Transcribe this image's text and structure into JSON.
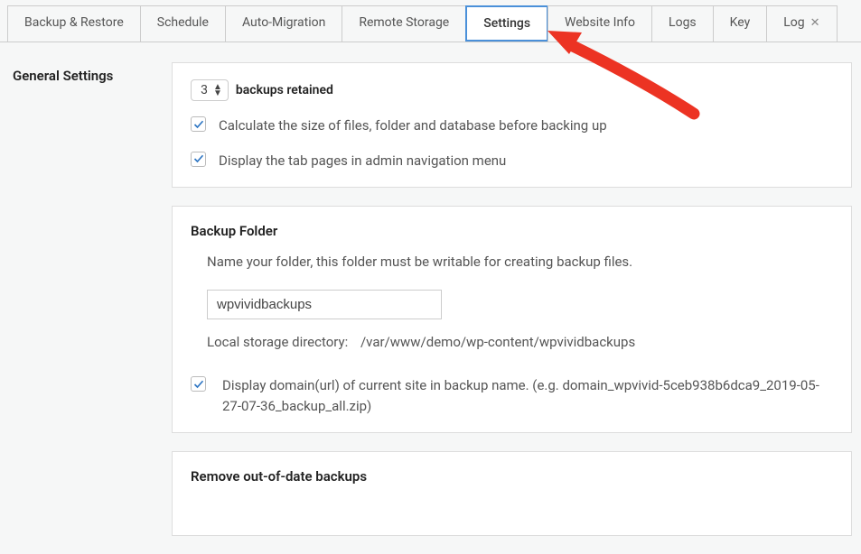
{
  "tabs": {
    "items": [
      {
        "label": "Backup & Restore"
      },
      {
        "label": "Schedule"
      },
      {
        "label": "Auto-Migration"
      },
      {
        "label": "Remote Storage"
      },
      {
        "label": "Settings"
      },
      {
        "label": "Website Info"
      },
      {
        "label": "Logs"
      },
      {
        "label": "Key"
      },
      {
        "label": "Log"
      }
    ],
    "close_glyph": "✕"
  },
  "section_title": "General Settings",
  "retain": {
    "count": "3",
    "label": "backups retained"
  },
  "opt_calculate": "Calculate the size of files, folder and database before backing up",
  "opt_display_tabs": "Display the tab pages in admin navigation menu",
  "backup_folder": {
    "title": "Backup Folder",
    "desc": "Name your folder, this folder must be writable for creating backup files.",
    "folder_name": "wpvividbackups",
    "dir_label": "Local storage directory:",
    "dir_path": "/var/www/demo/wp-content/wpvividbackups",
    "display_domain": "Display domain(url) of current site in backup name. (e.g. domain_wpvivid-5ceb938b6dca9_2019-05-27-07-36_backup_all.zip)"
  },
  "remove_title": "Remove out-of-date backups"
}
